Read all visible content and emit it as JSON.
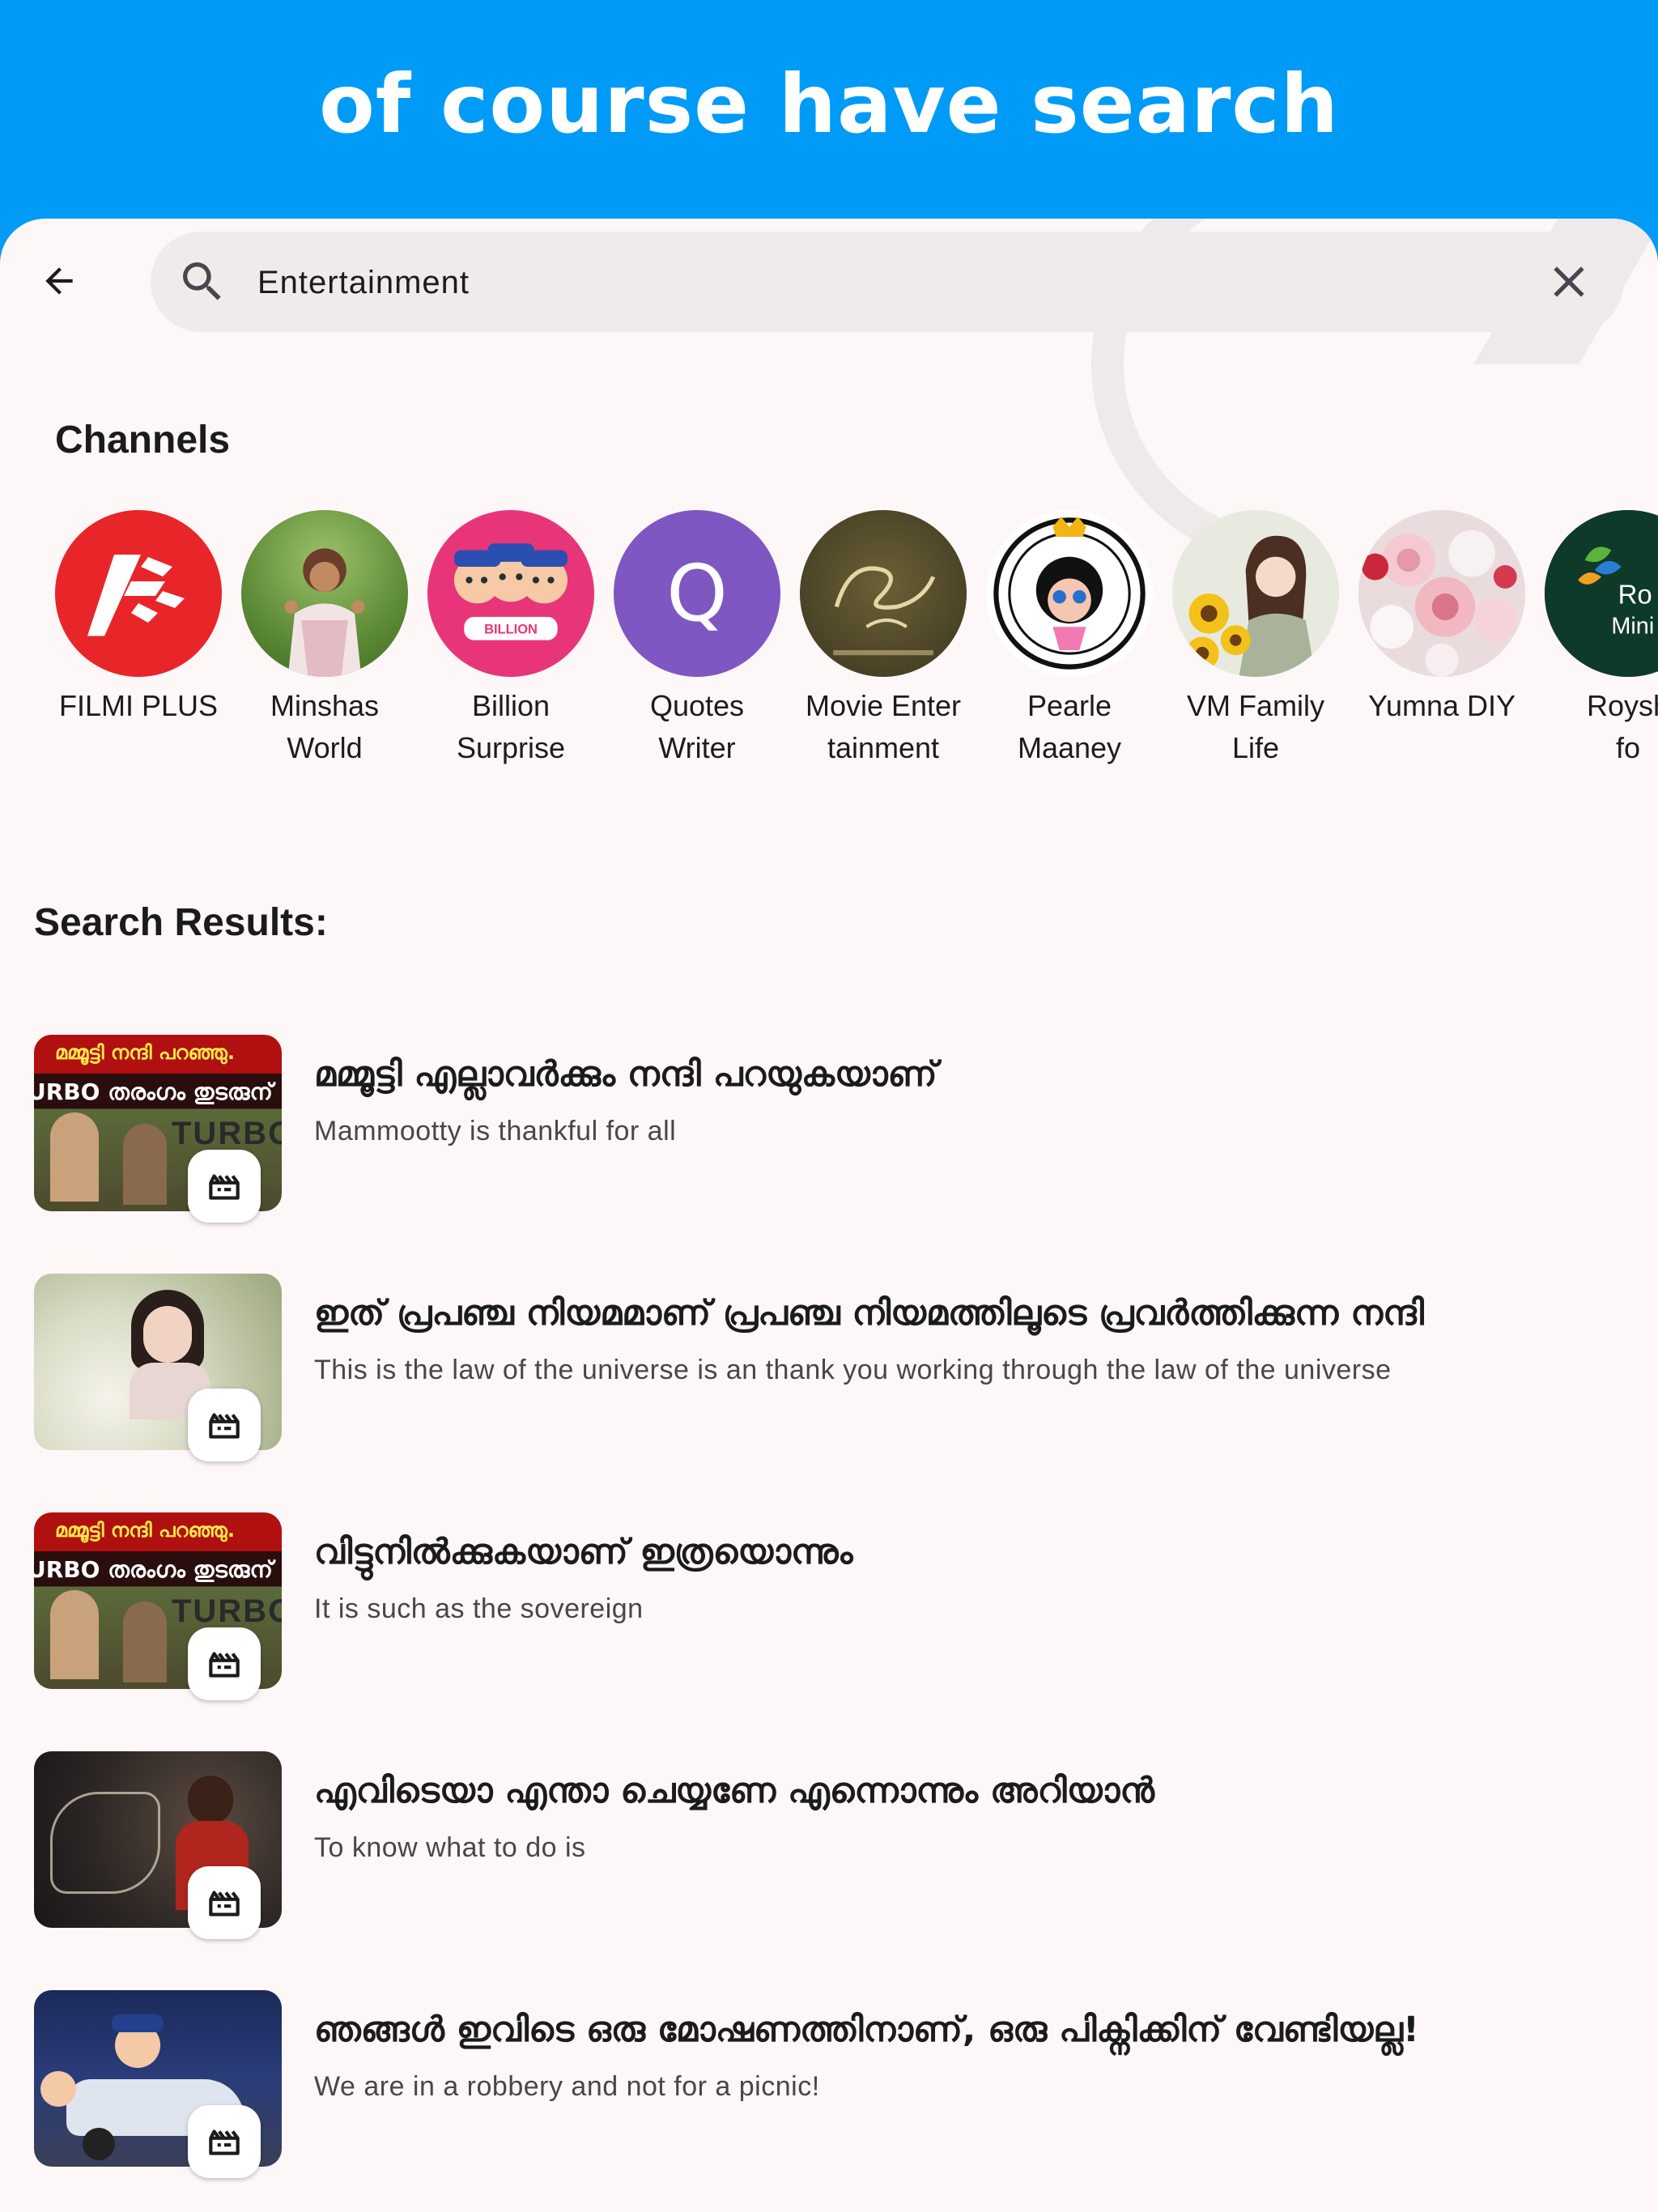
{
  "banner": {
    "title": "of course have search"
  },
  "search": {
    "value": "Entertainment"
  },
  "channels": {
    "title": "Channels",
    "items": [
      {
        "name": "FILMI PLUS",
        "icon": "filmi-plus-logo"
      },
      {
        "name": "Minshas\nWorld",
        "icon": "person-photo"
      },
      {
        "name": "Billion\nSurprise",
        "icon": "billion-surprise-logo"
      },
      {
        "name": "Quotes\nWriter",
        "letter": "Q"
      },
      {
        "name": "Movie Enter\ntainment",
        "icon": "movie-poster"
      },
      {
        "name": "Pearle\nMaaney",
        "icon": "pearle-maaney-logo"
      },
      {
        "name": "VM Family\nLife",
        "icon": "sunflower-girl-photo"
      },
      {
        "name": "Yumna DIY",
        "icon": "flowers-photo"
      },
      {
        "name": "Roysh\nfo",
        "icon": "roysh-logo"
      }
    ]
  },
  "results": {
    "title": "Search Results:",
    "items": [
      {
        "title": "മമ്മൂട്ടി എല്ലാവർക്കും നന്ദി പറയുകയാണ്",
        "subtitle": "Mammootty is thankful for all"
      },
      {
        "title": "ഇത് പ്രപഞ്ച നിയമമാണ് പ്രപഞ്ച നിയമത്തിലൂടെ പ്രവർത്തിക്കുന്ന നന്ദി",
        "subtitle": "This is the law of the universe is an thank you working through the law of the universe"
      },
      {
        "title": "വിട്ടുനിൽക്കുകയാണ് ഇത്രയൊന്നും",
        "subtitle": "It is such as the sovereign"
      },
      {
        "title": "എവിടെയാ എന്താ ചെയ്യണേ എന്നൊന്നും അറിയാൻ",
        "subtitle": "To know what to do is"
      },
      {
        "title": "ഞങ്ങൾ ഇവിടെ ഒരു മോഷണത്തിനാണ്, ഒരു പിക്നിക്കിന് വേണ്ടിയല്ല!",
        "subtitle": "We are in a robbery and not for a picnic!"
      }
    ]
  },
  "thumbs": {
    "t1_top": "മമ്മൂട്ടി നന്ദി പറഞ്ഞു.",
    "t1_mid": "URBO തരംഗം തുടരുന്",
    "t1_word": "TURBO"
  },
  "colors": {
    "banner": "#009BF6",
    "surface": "#FDF7F7",
    "search_bg": "#EFEBEB",
    "quotes_avatar": "#7E57C2",
    "filmi_red": "#E8262A"
  }
}
